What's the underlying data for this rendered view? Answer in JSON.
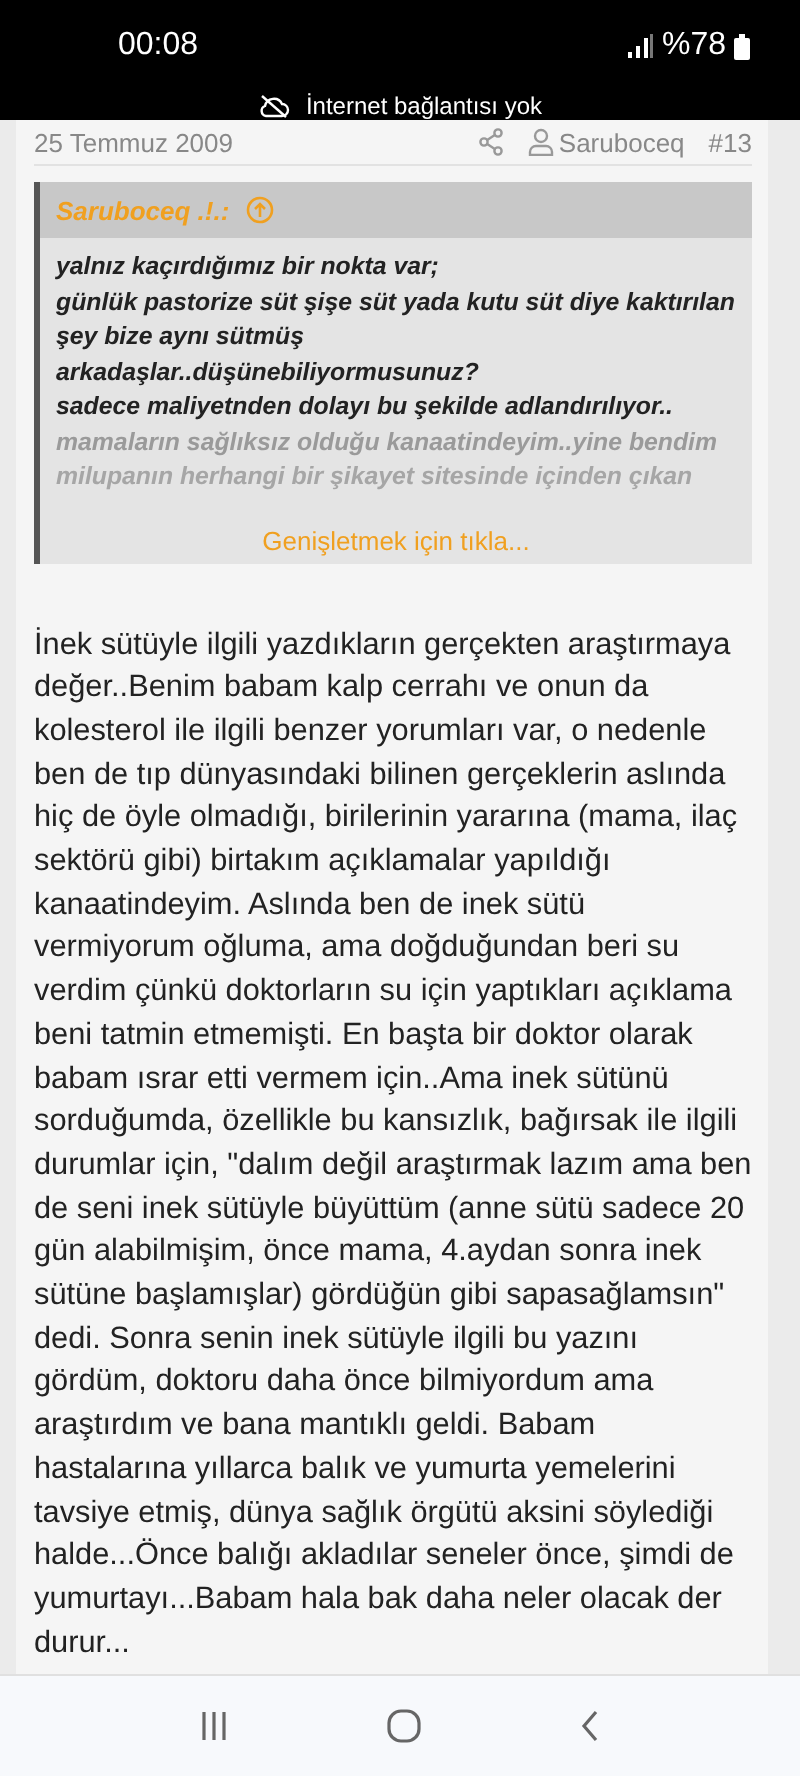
{
  "status_bar": {
    "time": "00:08",
    "battery": "%78",
    "notice": "İnternet bağlantısı yok"
  },
  "post": {
    "date": "25 Temmuz 2009",
    "author": "Saruboceq",
    "number": "#13",
    "quote": {
      "author": "Saruboceq .!.:",
      "lines": [
        {
          "text": "yalnız kaçırdığımız bir nokta var;",
          "faded": false
        },
        {
          "text": "günlük pastorize süt şişe süt yada kutu süt diye kaktırılan şey bize aynı sütmüş",
          "faded": false
        },
        {
          "text": "arkadaşlar..düşünebiliyormusunuz?",
          "faded": false
        },
        {
          "text": "sadece maliyetnden dolayı bu şekilde adlandırılıyor..",
          "faded": false
        },
        {
          "text": "mamaların sağlıksız olduğu kanaatindeyim..yine bendim",
          "faded": true
        },
        {
          "text": "milupanın herhangi bir şikayet sitesinde içinden çıkan",
          "faded": true
        }
      ],
      "expand": "Genişletmek için tıkla..."
    },
    "body": "İnek sütüyle ilgili yazdıkların gerçekten araştırmaya değer..Benim babam kalp cerrahı ve onun da kolesterol ile ilgili benzer yorumları var, o nedenle ben de tıp dünyasındaki bilinen gerçeklerin aslında hiç de öyle olmadığı, birilerinin yararına (mama, ilaç sektörü gibi) birtakım açıklamalar yapıldığı kanaatindeyim. Aslında ben de inek sütü vermiyorum oğluma, ama doğduğundan beri su verdim çünkü doktorların su için yaptıkları açıklama beni tatmin etmemişti. En başta bir doktor olarak babam ısrar etti vermem için..Ama inek sütünü sorduğumda, özellikle bu kansızlık, bağırsak ile ilgili durumlar için, \"dalım değil araştırmak lazım ama ben de seni inek sütüyle büyüttüm (anne sütü sadece 20 gün alabilmişim, önce mama, 4.aydan sonra inek sütüne başlamışlar) gördüğün gibi sapasağlamsın\" dedi. Sonra senin inek sütüyle ilgili bu yazını gördüm, doktoru daha önce bilmiyordum ama araştırdım ve bana mantıklı geldi. Babam hastalarına yıllarca balık ve yumurta yemelerini tavsiye etmiş, dünya sağlık örgütü aksini söylediği halde...Önce balığı akladılar seneler önce, şimdi de yumurtayı...Babam hala bak daha neler olacak der durur..."
  }
}
